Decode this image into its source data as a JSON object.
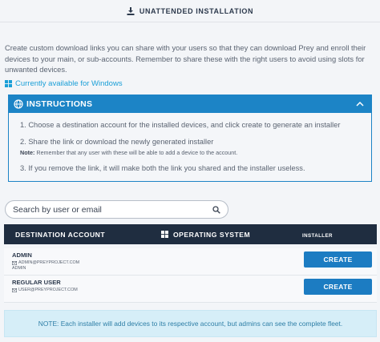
{
  "header": {
    "title": "UNATTENDED INSTALLATION",
    "icon": "download-icon"
  },
  "description": "Create custom download links you can share with your users so that they can download Prey and enroll their devices to your main, or sub-accounts. Remember to share these with the right users to avoid using slots for unwanted devices.",
  "availability": {
    "text": "Currently available for Windows",
    "icon": "windows-icon",
    "color": "#1a9fd7"
  },
  "instructions": {
    "title": "INSTRUCTIONS",
    "accent_color": "#1c84c6",
    "steps": [
      "1. Choose a destination account for the installed devices, and click create to generate an installer",
      "2. Share the link or download the newly generated installer",
      "3. If you remove the link, it will make both the link you shared and the installer useless."
    ],
    "note_label": "Note:",
    "note_text": " Remember that any user with these will be able to add a device to the account."
  },
  "search": {
    "placeholder": "Search by user or email",
    "value": ""
  },
  "table": {
    "headers": {
      "destination": "DESTINATION ACCOUNT",
      "os": "OPERATING SYSTEM",
      "installer": "INSTALLER"
    },
    "header_color": "#1f2d40",
    "rows": [
      {
        "name": "ADMIN",
        "email": "ADMIN@PREYPROJECT.COM",
        "role": "ADMIN",
        "button": "CREATE"
      },
      {
        "name": "REGULAR USER",
        "email": "USER@PREYPROJECT.COM",
        "role": "",
        "button": "CREATE"
      }
    ]
  },
  "footer_note": "NOTE: Each installer will add devices to its respective account, but admins can see the complete fleet."
}
